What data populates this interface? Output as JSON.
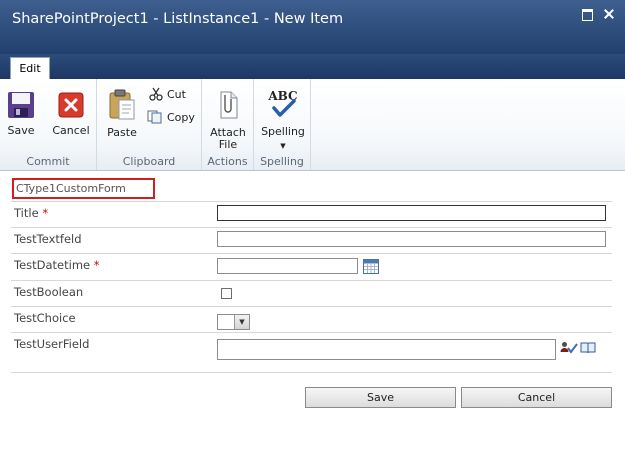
{
  "window": {
    "title": "SharePointProject1 - ListInstance1 - New Item"
  },
  "ribbon": {
    "tab_label": "Edit",
    "commit": {
      "label": "Commit",
      "save": "Save",
      "cancel": "Cancel"
    },
    "clipboard": {
      "label": "Clipboard",
      "paste": "Paste",
      "cut": "Cut",
      "copy": "Copy"
    },
    "actions": {
      "label": "Actions",
      "attach_line1": "Attach",
      "attach_line2": "File"
    },
    "spelling": {
      "label": "Spelling",
      "button": "Spelling",
      "icon_text": "ABC"
    }
  },
  "form": {
    "name": "CType1CustomForm",
    "fields": [
      {
        "label": "Title",
        "required": "*",
        "value": ""
      },
      {
        "label": "TestTextfeld",
        "required": "",
        "value": ""
      },
      {
        "label": "TestDatetime",
        "required": "*",
        "value": ""
      },
      {
        "label": "TestBoolean",
        "required": "",
        "checked": false
      },
      {
        "label": "TestChoice",
        "required": "",
        "value": ""
      },
      {
        "label": "TestUserField",
        "required": "",
        "value": ""
      }
    ],
    "save_label": "Save",
    "cancel_label": "Cancel"
  }
}
